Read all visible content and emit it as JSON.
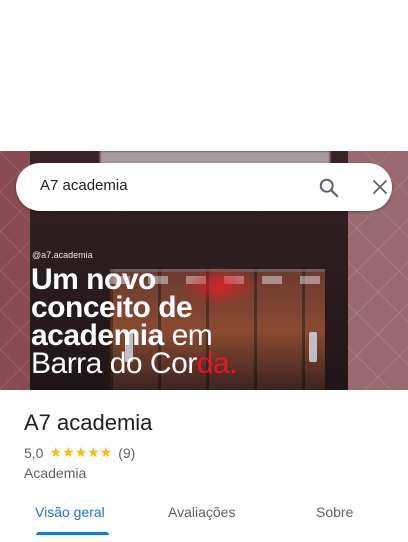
{
  "search": {
    "query": "A7 academia"
  },
  "hero": {
    "handle": "@a7.academia",
    "headline": {
      "line1": "Um novo",
      "line2": "conceito de",
      "line3_bold": "academia",
      "line3_light": "em",
      "line4_light": "Barra do Cor",
      "line4_red": "da."
    }
  },
  "place": {
    "name": "A7 academia",
    "rating": "5,0",
    "stars": "★★★★★",
    "review_count": "(9)",
    "category": "Academia"
  },
  "tabs": [
    {
      "label": "Visão geral",
      "active": true
    },
    {
      "label": "Avaliações",
      "active": false
    },
    {
      "label": "Sobre",
      "active": false
    }
  ],
  "colors": {
    "accent": "#1a73e8",
    "star": "#fbbc04",
    "brand_red": "#e3172a"
  }
}
